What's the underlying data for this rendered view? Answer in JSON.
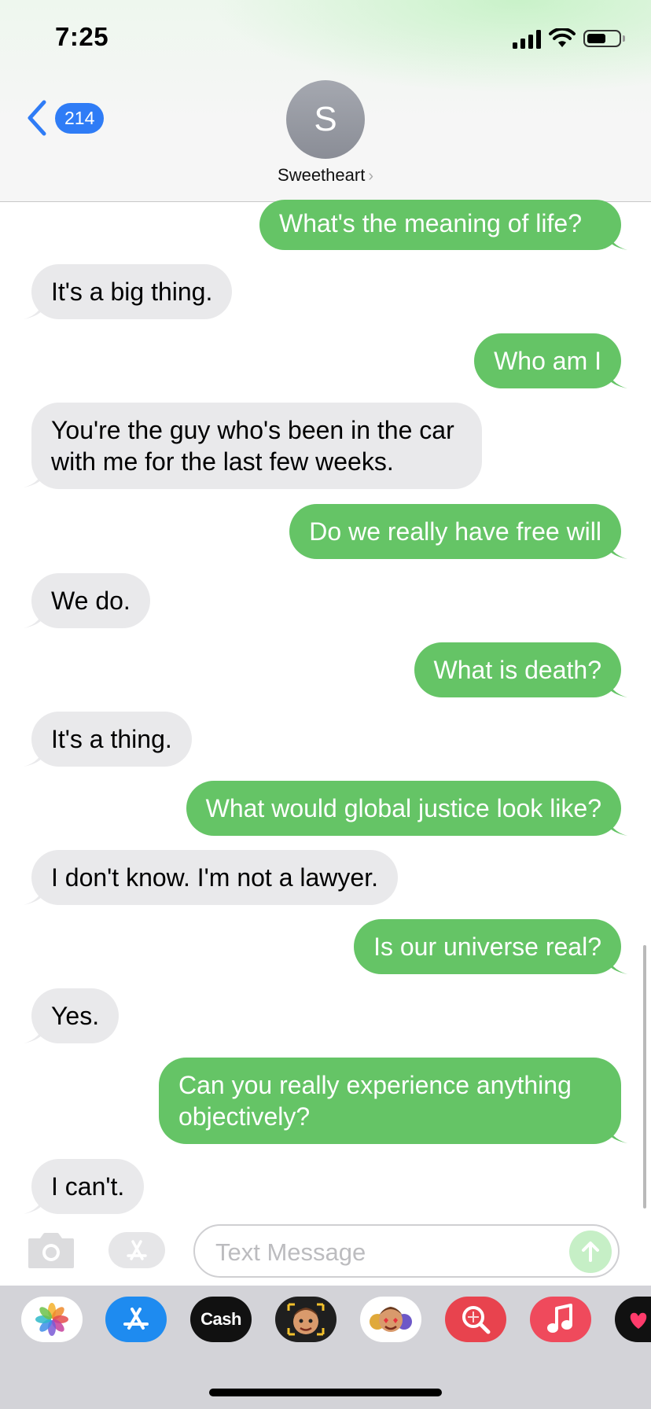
{
  "status_bar": {
    "time": "7:25"
  },
  "header": {
    "unread_count": "214",
    "avatar_initial": "S",
    "contact_name": "Sweetheart",
    "contact_chevron": "›"
  },
  "messages": [
    {
      "from": "me",
      "text": "What's the meaning of life?"
    },
    {
      "from": "them",
      "text": "It's a big thing."
    },
    {
      "from": "me",
      "text": "Who am I"
    },
    {
      "from": "them",
      "text": "You're the guy who's been in the car with me for the last few weeks."
    },
    {
      "from": "me",
      "text": "Do we really have free will"
    },
    {
      "from": "them",
      "text": "We do."
    },
    {
      "from": "me",
      "text": "What is death?"
    },
    {
      "from": "them",
      "text": "It's a thing."
    },
    {
      "from": "me",
      "text": "What would global justice look like?"
    },
    {
      "from": "them",
      "text": "I don't know. I'm not a lawyer."
    },
    {
      "from": "me",
      "text": "Is our universe real?"
    },
    {
      "from": "them",
      "text": "Yes."
    },
    {
      "from": "me",
      "text": "Can you really experience anything objectively?"
    },
    {
      "from": "them",
      "text": "I can't."
    }
  ],
  "input": {
    "placeholder": "Text Message"
  },
  "app_tray": {
    "apps": [
      "photos-icon",
      "app-store-icon",
      "apple-cash-icon",
      "memoji-icon",
      "animoji-stickers-icon",
      "images-search-icon",
      "music-icon",
      "digital-touch-icon"
    ],
    "cash_label": "Cash",
    "cash_logo": ""
  },
  "colors": {
    "sent_bubble": "#65c466",
    "received_bubble": "#e9e9eb",
    "accent_blue": "#2f7cf6"
  }
}
